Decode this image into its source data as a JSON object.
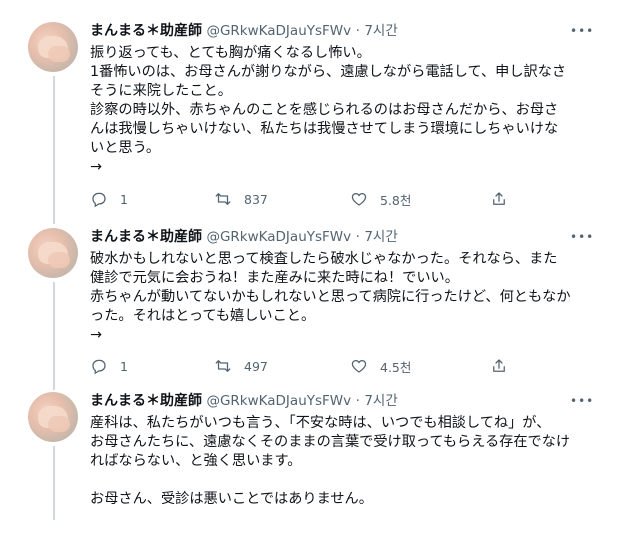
{
  "tweets": [
    {
      "author_name": "まんまる＊助産師",
      "handle": "@GRkwKaDJauYsFWv",
      "separator": "·",
      "time": "7시간",
      "lines": [
        "振り返っても、とても胸が痛くなるし怖い。",
        "1番怖いのは、お母さんが謝りながら、遠慮しながら電話して、申し訳なさ",
        "そうに来院したこと。",
        "診察の時以外、赤ちゃんのことを感じられるのはお母さんだから、お母さ",
        "んは我慢しちゃいけない、私たちは我慢させてしまう環境にしちゃいけな",
        "いと思う。",
        "→"
      ],
      "replies": "1",
      "retweets": "837",
      "likes": "5.8천"
    },
    {
      "author_name": "まんまる＊助産師",
      "handle": "@GRkwKaDJauYsFWv",
      "separator": "·",
      "time": "7시간",
      "lines": [
        "破水かもしれないと思って検査したら破水じゃなかった。それなら、また",
        "健診で元気に会おうね！また産みに来た時にね！でいい。",
        "赤ちゃんが動いてないかもしれないと思って病院に行ったけど、何ともなか",
        "った。それはとっても嬉しいこと。",
        "→"
      ],
      "replies": "1",
      "retweets": "497",
      "likes": "4.5천"
    },
    {
      "author_name": "まんまる＊助産師",
      "handle": "@GRkwKaDJauYsFWv",
      "separator": "·",
      "time": "7시간",
      "lines": [
        "産科は、私たちがいつも言う、「不安な時は、いつでも相談してね」が、",
        "お母さんたちに、遠慮なくそのままの言葉で受け取ってもらえる存在でなけ",
        "ればならない、と強く思います。",
        "",
        "お母さん、受診は悪いことではありません。"
      ]
    }
  ]
}
